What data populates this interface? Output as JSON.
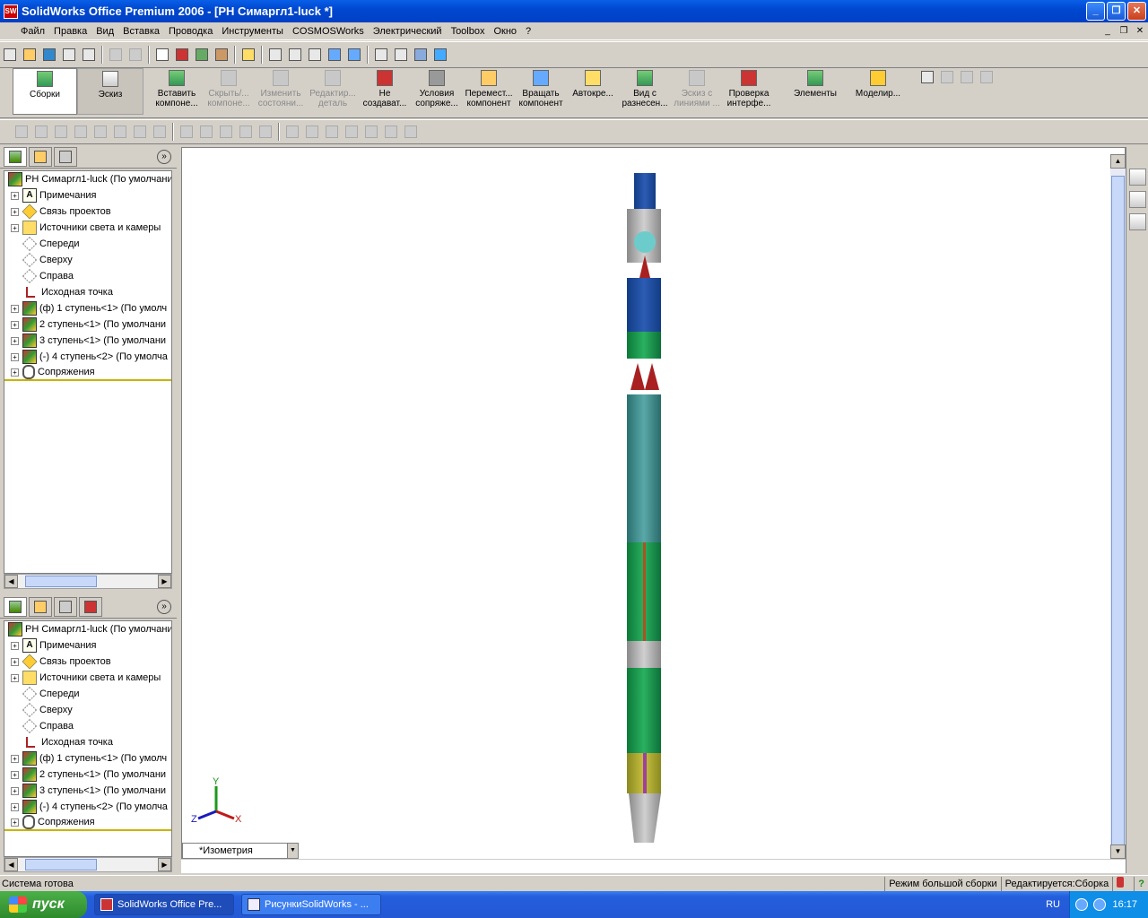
{
  "window": {
    "title": "SolidWorks Office Premium 2006 - [PH Симаргл1-luck *]",
    "app_icon": "SW",
    "controls": [
      "_",
      "❐",
      "✕"
    ]
  },
  "menu": {
    "items": [
      "Файл",
      "Правка",
      "Вид",
      "Вставка",
      "Проводка",
      "Инструменты",
      "COSMOSWorks",
      "Электрический",
      "Toolbox",
      "Окно",
      "?"
    ],
    "mdi_controls": [
      "_",
      "❐",
      "✕"
    ]
  },
  "command_manager": {
    "tabs": [
      {
        "label": "Сборки",
        "state": "active"
      },
      {
        "label": "Эскиз",
        "state": "inactive"
      }
    ],
    "buttons": [
      {
        "label": "Вставить компоне...",
        "enabled": true
      },
      {
        "label": "Скрыть/... компоне...",
        "enabled": false
      },
      {
        "label": "Изменить состояни...",
        "enabled": false
      },
      {
        "label": "Редактир... деталь",
        "enabled": false
      },
      {
        "label": "Не создават...",
        "enabled": true
      },
      {
        "label": "Условия сопряже...",
        "enabled": true
      },
      {
        "label": "Перемест... компонент",
        "enabled": true
      },
      {
        "label": "Вращать компонент",
        "enabled": true
      },
      {
        "label": "Автокре...",
        "enabled": true
      },
      {
        "label": "Вид с разнесен...",
        "enabled": true
      },
      {
        "label": "Эскиз с линиями ...",
        "enabled": false
      },
      {
        "label": "Проверка интерфе...",
        "enabled": true
      },
      {
        "label": "Элементы",
        "enabled": true
      },
      {
        "label": "Моделир...",
        "enabled": true
      }
    ]
  },
  "feature_tree": {
    "root": "PH Симаргл1-luck  (По умолчани",
    "nodes": [
      {
        "label": "Примечания",
        "icon": "note-icon",
        "expand": true
      },
      {
        "label": "Связь проектов",
        "icon": "link-icon",
        "expand": true
      },
      {
        "label": "Источники света и камеры",
        "icon": "light-icon",
        "expand": true
      },
      {
        "label": "Спереди",
        "icon": "plane-icon",
        "expand": false
      },
      {
        "label": "Сверху",
        "icon": "plane-icon",
        "expand": false
      },
      {
        "label": "Справа",
        "icon": "plane-icon",
        "expand": false
      },
      {
        "label": "Исходная точка",
        "icon": "origin-icon",
        "expand": false
      },
      {
        "label": "(ф) 1 ступень<1> (По умолч",
        "icon": "assembly-icon",
        "expand": true
      },
      {
        "label": "2 ступень<1> (По умолчани",
        "icon": "assembly-icon",
        "expand": true
      },
      {
        "label": "3 ступень<1> (По умолчани",
        "icon": "assembly-icon",
        "expand": true
      },
      {
        "label": "(-) 4 ступень<2> (По умолча",
        "icon": "assembly-icon",
        "expand": true
      },
      {
        "label": "Сопряжения",
        "icon": "mates-icon",
        "expand": true
      }
    ]
  },
  "viewport": {
    "view_name": "*Изометрия",
    "triad": {
      "x": "X",
      "y": "Y",
      "z": "Z"
    }
  },
  "status": {
    "message": "Система готова",
    "mode": "Режим большой сборки",
    "editing": "Редактируется:Сборка",
    "help": "?"
  },
  "taskbar": {
    "start": "пуск",
    "tasks": [
      {
        "label": "SolidWorks Office Pre...",
        "active": true
      },
      {
        "label": "РисункиSolidWorks - ...",
        "active": false
      }
    ],
    "lang": "RU",
    "clock": "16:17"
  },
  "colors": {
    "title_blue": "#0048d0",
    "taskbar_blue": "#245edc",
    "start_green": "#2e8a2c",
    "model_teal": "#3a8c8c",
    "model_green": "#1a9a4a",
    "model_blue": "#1e4a9c"
  }
}
